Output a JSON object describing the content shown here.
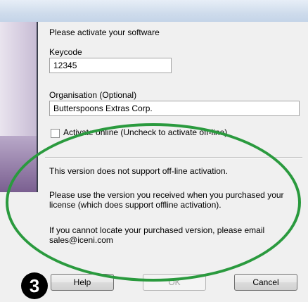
{
  "dialog": {
    "intro": "Please activate your software",
    "keycode_label": "Keycode",
    "keycode_value": "12345",
    "organisation_label": "Organisation (Optional)",
    "organisation_value": "Butterspoons Extras Corp.",
    "activate_online_label": "Activate online (Uncheck to activate off-line)",
    "activate_online_checked": false,
    "message_1": "This version does not support off-line activation.",
    "message_2": "Please use the version you received when you purchased your license (which does support offline activation).",
    "message_3": "If you cannot locate your purchased version, please email sales@iceni.com"
  },
  "buttons": {
    "help": "Help",
    "ok": "OK",
    "cancel": "Cancel"
  },
  "annotation": {
    "step_number": "3",
    "ellipse_color": "#2a9a3e"
  }
}
